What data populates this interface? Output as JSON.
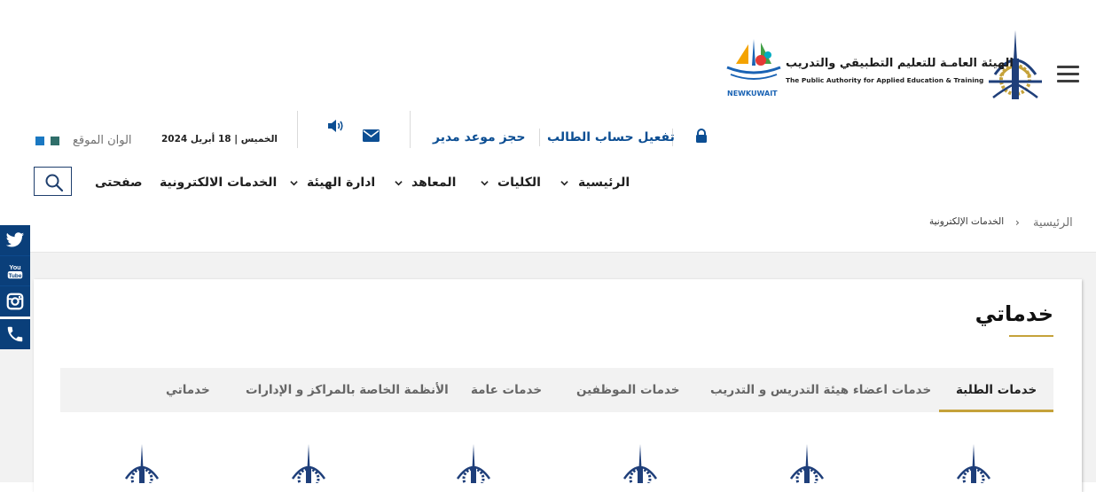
{
  "header": {
    "authority_name_ar": "الهيئة العامـة  للتعليم التطبيقي والتدريب",
    "authority_name_en": "The Public Authority for Applied Education & Training",
    "new_kuwait_label": "NEWKUWAIT"
  },
  "utility": {
    "activate_account": "تفعيل حساب الطالب",
    "book_appointment": "حجز موعد مدير",
    "date": "الخميس | 18 أبريل 2024",
    "site_colors_label": "الوان الموقع",
    "color_swatches": [
      "#2f6e6a",
      "#1a78c2"
    ]
  },
  "nav": {
    "items": [
      {
        "label": "الرئيسية",
        "dropdown": true
      },
      {
        "label": "الكليات",
        "dropdown": true
      },
      {
        "label": "المعاهد",
        "dropdown": true
      },
      {
        "label": "ادارة الهيئة",
        "dropdown": true
      },
      {
        "label": "الخدمات الالكترونية",
        "dropdown": false
      },
      {
        "label": "صفحتى",
        "dropdown": false
      }
    ]
  },
  "breadcrumb": {
    "home": "الرئيسية",
    "separator": "›",
    "current": "الخدمات الإلكترونية"
  },
  "social": [
    "twitter-icon",
    "youtube-icon",
    "instagram-icon",
    "phone-icon"
  ],
  "youtube_glyph": {
    "line1": "You",
    "line2": "Tube"
  },
  "main": {
    "title": "خدماتي",
    "tabs": [
      {
        "label": "خدمات الطلبة",
        "active": true
      },
      {
        "label": "خدمات اعضاء هيئة التدريس و التدريب",
        "active": false
      },
      {
        "label": "خدمات الموظفين",
        "active": false
      },
      {
        "label": "خدمات عامة",
        "active": false
      },
      {
        "label": "الأنظمة الخاصة بالمراكز و الإدارات",
        "active": false
      },
      {
        "label": "خدماتي",
        "active": false
      }
    ]
  },
  "colors": {
    "brand_blue": "#0c4e93",
    "gold_accent": "#c5a23a",
    "social_bg": "#0a3f7a"
  }
}
